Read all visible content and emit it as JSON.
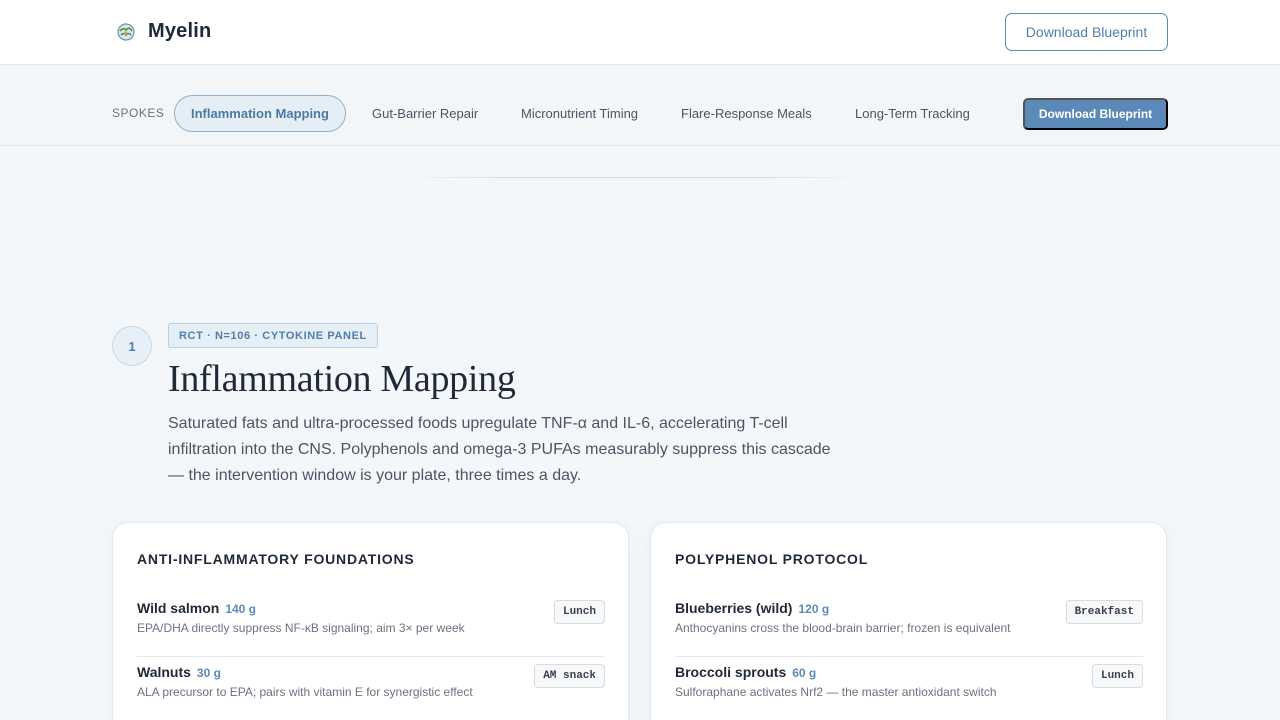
{
  "brand": {
    "name": "Myelin",
    "logo_icon": "brain-globe-icon"
  },
  "header": {
    "download_label": "Download Blueprint"
  },
  "spokes": {
    "label": "SPOKES",
    "items": [
      {
        "label": "Inflammation Mapping",
        "active": true
      },
      {
        "label": "Gut-Barrier Repair",
        "active": false
      },
      {
        "label": "Micronutrient Timing",
        "active": false
      },
      {
        "label": "Flare-Response Meals",
        "active": false
      },
      {
        "label": "Long-Term Tracking",
        "active": false
      }
    ],
    "download_label": "Download Blueprint"
  },
  "section": {
    "number": "1",
    "tag": "RCT · N=106 · CYTOKINE PANEL",
    "title": "Inflammation Mapping",
    "description": "Saturated fats and ultra-processed foods upregulate TNF-α and IL-6, accelerating T-cell infiltration into the CNS. Polyphenols and omega-3 PUFAs measurably suppress this cascade — the intervention window is your plate, three times a day."
  },
  "cards": [
    {
      "title": "ANTI-INFLAMMATORY FOUNDATIONS",
      "items": [
        {
          "name": "Wild salmon",
          "qty": "140 g",
          "note": "EPA/DHA directly suppress NF-κB signaling; aim 3× per week",
          "meal": "Lunch"
        },
        {
          "name": "Walnuts",
          "qty": "30 g",
          "note": "ALA precursor to EPA; pairs with vitamin E for synergistic effect",
          "meal": "AM snack"
        }
      ]
    },
    {
      "title": "POLYPHENOL PROTOCOL",
      "items": [
        {
          "name": "Blueberries (wild)",
          "qty": "120 g",
          "note": "Anthocyanins cross the blood-brain barrier; frozen is equivalent",
          "meal": "Breakfast"
        },
        {
          "name": "Broccoli sprouts",
          "qty": "60 g",
          "note": "Sulforaphane activates Nrf2 — the master antioxidant switch",
          "meal": "Lunch"
        }
      ]
    }
  ],
  "colors": {
    "accent": "#5b8ab8",
    "background": "#f4f7fa"
  }
}
